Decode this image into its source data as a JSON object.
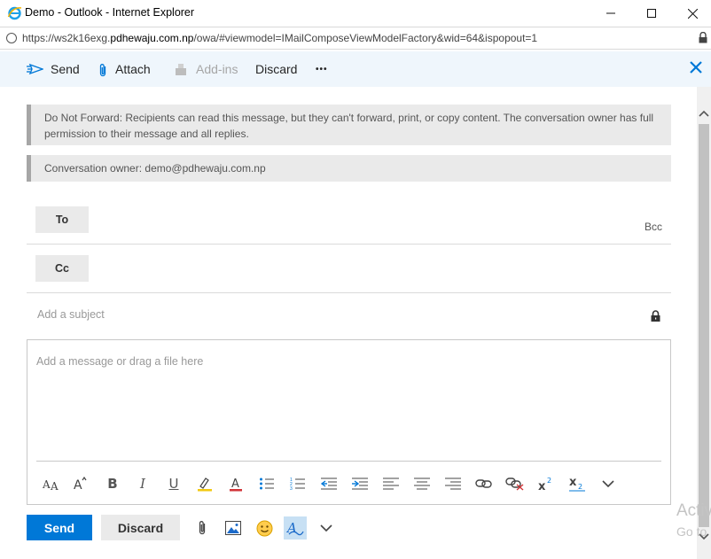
{
  "window": {
    "title": "Demo - Outlook - Internet Explorer",
    "minimize_icon": "minimize-icon",
    "maximize_icon": "maximize-icon",
    "close_icon": "close-icon"
  },
  "address": {
    "url_prefix": "https://ws2k16exg.",
    "url_domain": "pdhewaju.com.np",
    "url_suffix": "/owa/#viewmodel=IMailComposeViewModelFactory&wid=64&ispopout=1"
  },
  "command_bar": {
    "send": "Send",
    "attach": "Attach",
    "addins": "Add-ins",
    "discard": "Discard",
    "more": "•••"
  },
  "notices": {
    "do_not_forward": "Do Not Forward: Recipients can read this message, but they can't forward, print, or copy content. The conversation owner has full permission to their message and all replies.",
    "owner": "Conversation owner: demo@pdhewaju.com.np"
  },
  "recipients": {
    "to_label": "To",
    "cc_label": "Cc",
    "bcc_label": "Bcc"
  },
  "subject": {
    "placeholder": "Add a subject"
  },
  "body": {
    "placeholder": "Add a message or drag a file here"
  },
  "footer": {
    "send": "Send",
    "discard": "Discard"
  },
  "watermark": {
    "line1": "Activ",
    "line2": "Go to"
  },
  "colors": {
    "accent": "#0078d7",
    "command_bar_bg": "#eff6fc",
    "notice_bg": "#eaeaea"
  }
}
